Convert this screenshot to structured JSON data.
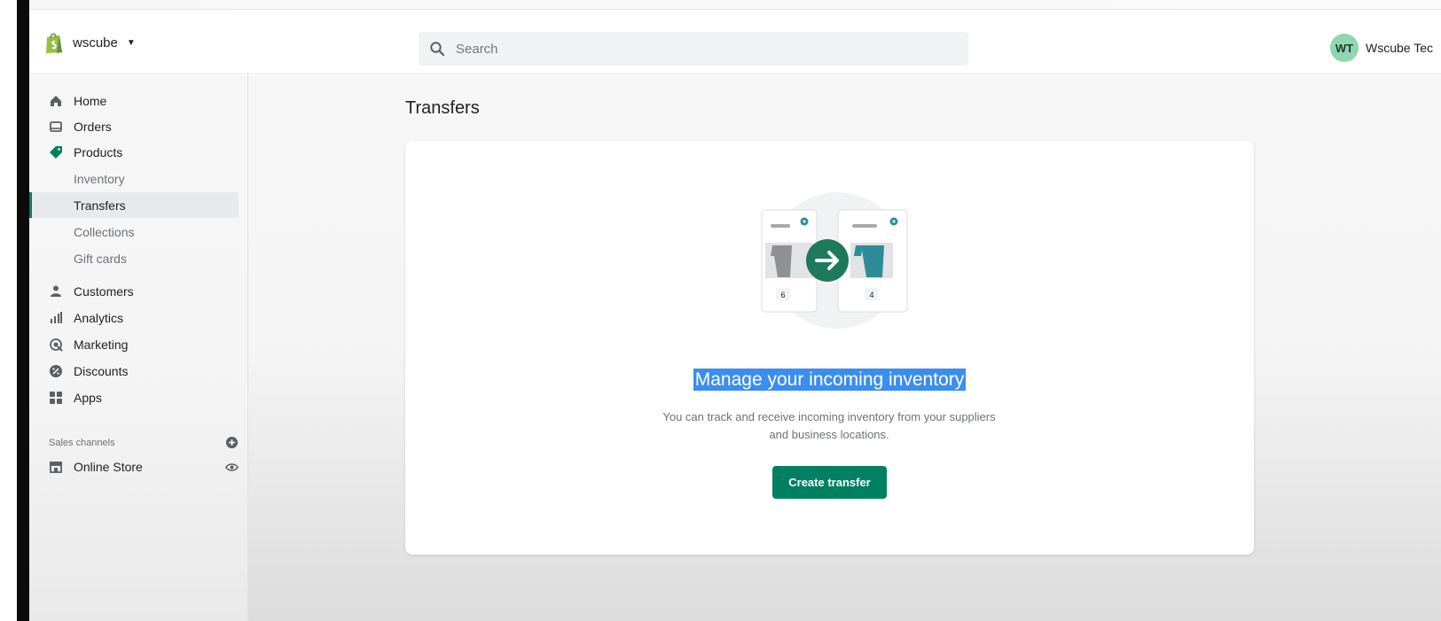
{
  "header": {
    "store_name": "wscube",
    "search_placeholder": "Search",
    "avatar_initials": "WT",
    "account_name": "Wscube Tec"
  },
  "sidebar": {
    "items": [
      {
        "label": "Home",
        "icon": "home-icon"
      },
      {
        "label": "Orders",
        "icon": "orders-icon"
      },
      {
        "label": "Products",
        "icon": "tag-icon"
      }
    ],
    "product_sub_items": [
      {
        "label": "Inventory"
      },
      {
        "label": "Transfers",
        "active": true
      },
      {
        "label": "Collections"
      },
      {
        "label": "Gift cards"
      }
    ],
    "items2": [
      {
        "label": "Customers",
        "icon": "person-icon"
      },
      {
        "label": "Analytics",
        "icon": "bar-chart-icon"
      },
      {
        "label": "Marketing",
        "icon": "target-icon"
      },
      {
        "label": "Discounts",
        "icon": "discount-icon"
      },
      {
        "label": "Apps",
        "icon": "grid-icon"
      }
    ],
    "sales_channels_label": "Sales channels",
    "online_store_label": "Online Store"
  },
  "main": {
    "page_title": "Transfers",
    "empty_state": {
      "heading": "Manage your incoming inventory",
      "description": "You can track and receive incoming inventory from your suppliers and business locations.",
      "button_label": "Create transfer",
      "illustration_counts": [
        "6",
        "4"
      ]
    }
  },
  "colors": {
    "brand_green": "#008060",
    "selection_blue": "#3b8df0",
    "avatar_bg": "#8fd6b1"
  }
}
